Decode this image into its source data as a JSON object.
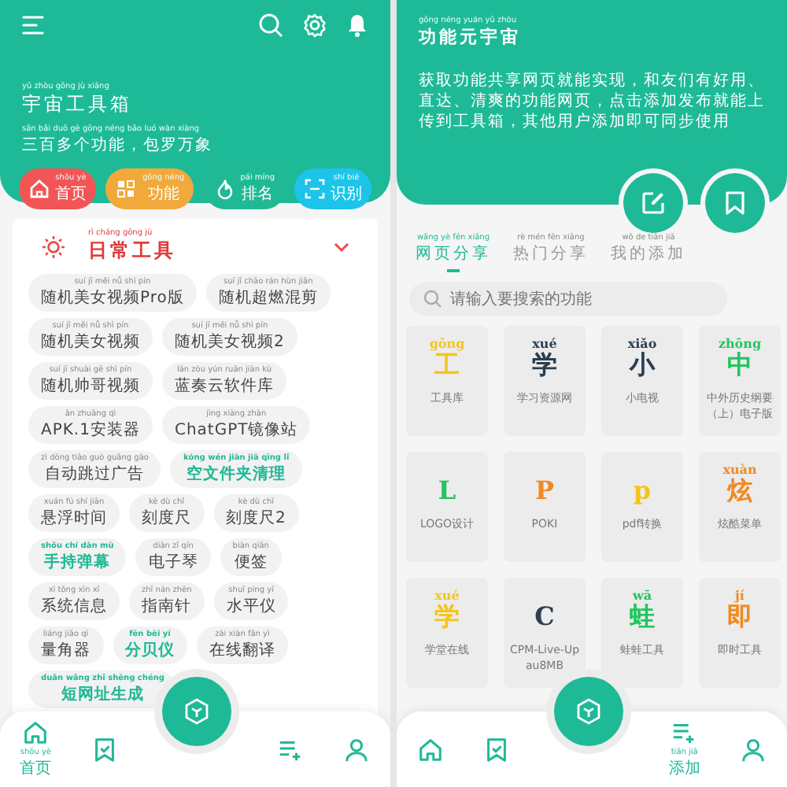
{
  "left": {
    "header": {
      "title": {
        "text": "宇宙工具箱",
        "pinyin": "yǔ zhòu gōng jù xiāng"
      },
      "subtitle": {
        "text": "三百多个功能，包罗万象",
        "pinyin": "sān bǎi duō gè gōng néng bāo luó wàn xiàng"
      }
    },
    "quick_buttons": [
      {
        "kind": "home",
        "label": "首页",
        "pinyin": "shǒu yè",
        "color": "#f25555"
      },
      {
        "kind": "grid",
        "label": "功能",
        "pinyin": "gōng néng",
        "color": "#f2a93b"
      },
      {
        "kind": "flame",
        "label": "排名",
        "pinyin": "pái míng",
        "color": "#1fb996"
      },
      {
        "kind": "scan",
        "label": "识别",
        "pinyin": "shí bié",
        "color": "#1cc4ea"
      }
    ],
    "section": {
      "title": "日常工具",
      "pinyin": "rì cháng gōng jù",
      "expanded": true
    },
    "tool_rows": [
      [
        {
          "label": "随机美女视频Pro版",
          "pinyin": "suí jī měi nǚ shì pín",
          "highlighted": false
        },
        {
          "label": "随机超燃混剪",
          "pinyin": "suí jī chāo rán hùn jiǎn",
          "highlighted": false
        }
      ],
      [
        {
          "label": "随机美女视频",
          "pinyin": "suí jī měi nǚ shì pín",
          "highlighted": false
        },
        {
          "label": "随机美女视频2",
          "pinyin": "suí jī měi nǚ shì pín",
          "highlighted": false
        }
      ],
      [
        {
          "label": "随机帅哥视频",
          "pinyin": "suí jī shuài gē shì pín",
          "highlighted": false
        },
        {
          "label": "蓝奏云软件库",
          "pinyin": "lán zòu yún ruǎn jiàn kù",
          "highlighted": false
        }
      ],
      [
        {
          "label": "APK.1安装器",
          "pinyin": "ān zhuāng qì",
          "highlighted": false
        },
        {
          "label": "ChatGPT镜像站",
          "pinyin": "jìng xiàng zhàn",
          "highlighted": false
        }
      ],
      [
        {
          "label": "自动跳过广告",
          "pinyin": "zì dòng tiào guò guǎng gào",
          "highlighted": false
        },
        {
          "label": "空文件夹清理",
          "pinyin": "kōng wén jiàn jiā qīng lǐ",
          "highlighted": true
        }
      ],
      [
        {
          "label": "悬浮时间",
          "pinyin": "xuán fú shí jiān",
          "highlighted": false
        },
        {
          "label": "刻度尺",
          "pinyin": "kè dù chǐ",
          "highlighted": false
        },
        {
          "label": "刻度尺2",
          "pinyin": "kè dù chǐ",
          "highlighted": false
        }
      ],
      [
        {
          "label": "手持弹幕",
          "pinyin": "shǒu chí dàn mù",
          "highlighted": true
        },
        {
          "label": "电子琴",
          "pinyin": "diàn zǐ qín",
          "highlighted": false
        },
        {
          "label": "便签",
          "pinyin": "biàn qiān",
          "highlighted": false
        }
      ],
      [
        {
          "label": "系统信息",
          "pinyin": "xì tǒng xìn xī",
          "highlighted": false
        },
        {
          "label": "指南针",
          "pinyin": "zhǐ nán zhēn",
          "highlighted": false
        },
        {
          "label": "水平仪",
          "pinyin": "shuǐ píng yí",
          "highlighted": false
        }
      ],
      [
        {
          "label": "量角器",
          "pinyin": "liáng jiǎo qì",
          "highlighted": false
        },
        {
          "label": "分贝仪",
          "pinyin": "fēn bèi yí",
          "highlighted": true
        },
        {
          "label": "在线翻译",
          "pinyin": "zài xiàn fān yì",
          "highlighted": false
        }
      ],
      [
        {
          "label": "短网址生成",
          "pinyin": "duǎn wǎng zhǐ shēng chéng",
          "highlighted": true
        }
      ]
    ],
    "nav": [
      {
        "kind": "home",
        "label": "首页",
        "pinyin": "shǒu yè"
      },
      {
        "kind": "bookmark"
      },
      {
        "kind": "cube"
      },
      {
        "kind": "playlist"
      },
      {
        "kind": "user"
      }
    ]
  },
  "right": {
    "header": {
      "title": {
        "text": "功能元宇宙",
        "pinyin": "gōng néng yuán yǔ zhòu"
      },
      "description": "获取功能共享网页就能实现，和友们有好用、直达、清爽的功能网页，点击添加发布就能上传到工具箱，其他用户添加即可同步使用"
    },
    "tabs": [
      {
        "label": "网页分享",
        "pinyin": "wǎng yè fēn xiǎng",
        "selected": true
      },
      {
        "label": "热门分享",
        "pinyin": "rè mén fēn xiǎng",
        "selected": false
      },
      {
        "label": "我的添加",
        "pinyin": "wǒ de tiān jiā",
        "selected": false
      }
    ],
    "search": {
      "placeholder": "请输入要搜索的功能"
    },
    "tiles": [
      {
        "glyph": "工",
        "pinyin": "gōng",
        "color": "#f5c518",
        "label": "工具库"
      },
      {
        "glyph": "学",
        "pinyin": "xué",
        "color": "#2c3e50",
        "label": "学习资源网"
      },
      {
        "glyph": "小",
        "pinyin": "xiǎo",
        "color": "#2c3e50",
        "label": "小电视"
      },
      {
        "glyph": "中",
        "pinyin": "zhōng",
        "color": "#22c55e",
        "label": "中外历史纲要（上）电子版"
      },
      {
        "glyph": "L",
        "color": "#22c55e",
        "label": "LOGO设计"
      },
      {
        "glyph": "P",
        "color": "#f08a24",
        "label": "POKI"
      },
      {
        "glyph": "p",
        "color": "#f5c518",
        "label": "pdf转换"
      },
      {
        "glyph": "炫",
        "pinyin": "xuàn",
        "color": "#f08a24",
        "label": "炫酷菜单"
      },
      {
        "glyph": "学",
        "pinyin": "xué",
        "color": "#f5c518",
        "label": "学堂在线"
      },
      {
        "glyph": "C",
        "color": "#2c3e50",
        "label": "CPM-Live-Up au8MB"
      },
      {
        "glyph": "蛙",
        "pinyin": "wā",
        "color": "#22c55e",
        "label": "蛙蛙工具"
      },
      {
        "glyph": "即",
        "pinyin": "jí",
        "color": "#f08a24",
        "label": "即时工具"
      }
    ],
    "nav": [
      {
        "kind": "home"
      },
      {
        "kind": "bookmark"
      },
      {
        "kind": "cube"
      },
      {
        "kind": "playlist",
        "label": "添加",
        "pinyin": "tiān jiā"
      },
      {
        "kind": "user"
      }
    ]
  }
}
